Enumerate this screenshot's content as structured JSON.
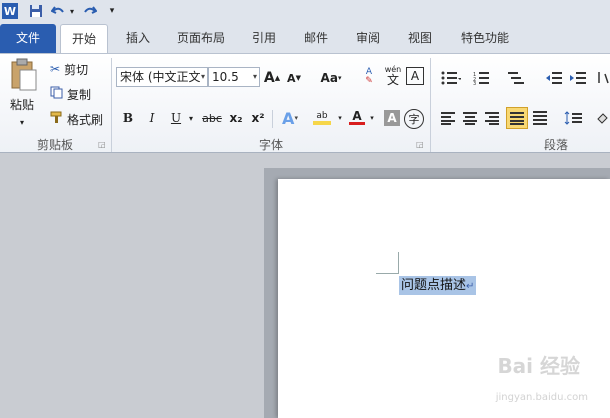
{
  "qat": {
    "icons": [
      "word-logo-icon",
      "save-icon",
      "undo-icon",
      "redo-icon",
      "customize-icon"
    ]
  },
  "tabs": [
    {
      "label": "文件"
    },
    {
      "label": "开始"
    },
    {
      "label": "插入"
    },
    {
      "label": "页面布局"
    },
    {
      "label": "引用"
    },
    {
      "label": "邮件"
    },
    {
      "label": "审阅"
    },
    {
      "label": "视图"
    },
    {
      "label": "特色功能"
    }
  ],
  "clipboard": {
    "paste": "粘贴",
    "cut": "剪切",
    "copy": "复制",
    "format_painter": "格式刷",
    "group": "剪贴板"
  },
  "font": {
    "family": "宋体 (中文正文",
    "size": "10.5",
    "group": "字体",
    "grow": "A",
    "shrink": "A",
    "case": "Aa",
    "bold": "B",
    "italic": "I",
    "underline": "U",
    "strike": "abc",
    "sub": "x₂",
    "sup": "x²",
    "clear": "A",
    "phonetic": "wén",
    "phonetic_char": "文",
    "border": "A",
    "text_effect": "A",
    "highlight": "ab",
    "font_color": "A",
    "shading": "A",
    "enclose": "字"
  },
  "paragraph": {
    "group": "段落"
  },
  "document": {
    "text": "问题点描述"
  },
  "watermark": {
    "main": "Bai 经验",
    "sub": "jingyan.baidu.com"
  },
  "colors": {
    "file_tab": "#2a5db0",
    "selection": "#a9c4e6",
    "highlight": "#f6d64a",
    "font_red": "#d81e1e"
  }
}
